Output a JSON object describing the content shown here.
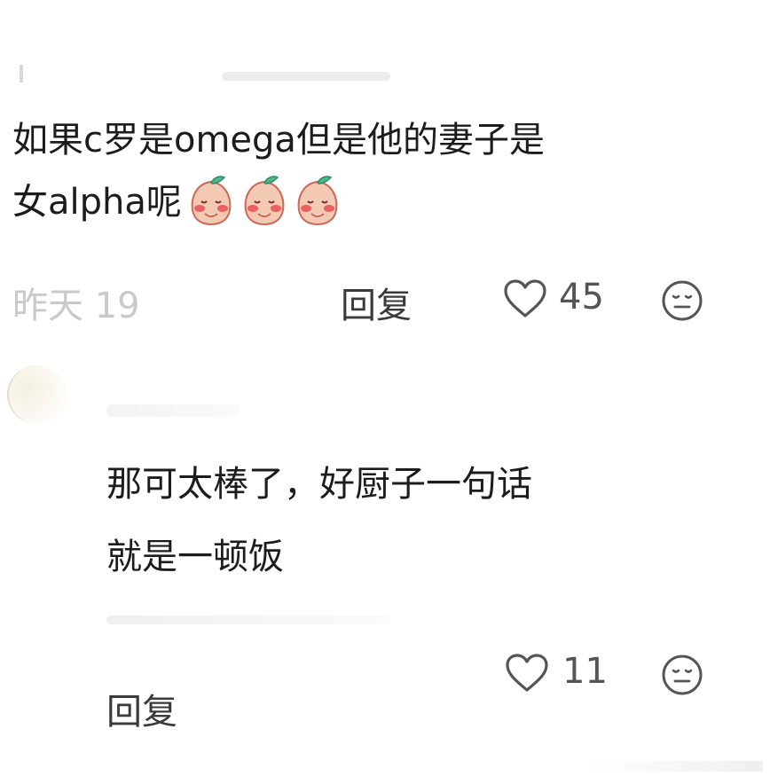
{
  "comment1": {
    "text_line1": "如果c罗是omega但是他的妻子是",
    "text_line2": "女alpha呢",
    "emojis": [
      "blushing-peach-emoji",
      "blushing-peach-emoji",
      "blushing-peach-emoji"
    ],
    "time_partial": "昨天 19",
    "reply_label": "回复",
    "like_count": "45"
  },
  "comment2": {
    "text_line1": "那可太棒了，好厨子一句话",
    "text_line2": "就是一顿饭",
    "reply_label": "回复",
    "like_count": "11"
  },
  "icons": {
    "like": "heart-outline-icon",
    "dislike": "neutral-face-icon"
  },
  "colors": {
    "text": "#1c1c1c",
    "meta": "#c9c9c9",
    "icon": "#555555",
    "peach": "#f3c9b3",
    "blush": "#e5484d",
    "leaf": "#4fb889"
  }
}
